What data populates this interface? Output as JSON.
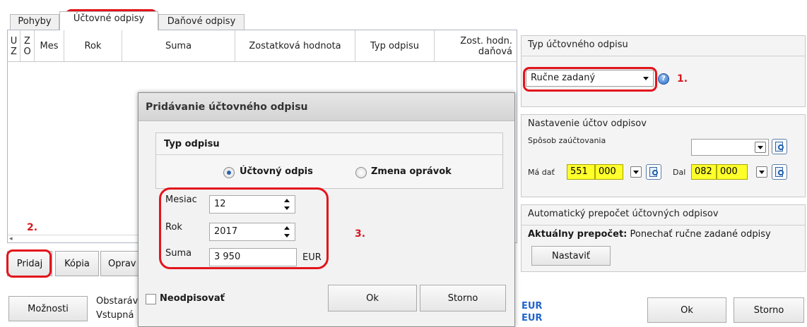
{
  "tabs": [
    {
      "label": "Pohyby",
      "active": false
    },
    {
      "label": "Účtovné odpisy",
      "active": true
    },
    {
      "label": "Daňové odpisy",
      "active": false
    }
  ],
  "grid": {
    "columns": [
      {
        "key": "uz",
        "label": "U Z"
      },
      {
        "key": "zo",
        "label": "Z O"
      },
      {
        "key": "mes",
        "label": "Mes"
      },
      {
        "key": "rok",
        "label": "Rok"
      },
      {
        "key": "suma",
        "label": "Suma"
      },
      {
        "key": "zostatkova",
        "label": "Zostatková hodnota"
      },
      {
        "key": "typ",
        "label": "Typ odpisu"
      },
      {
        "key": "zost_danova",
        "label": "Zost. hodn. daňová"
      }
    ],
    "rows": [],
    "buttons": {
      "pridaj": "Pridaj",
      "kopia": "Kópia",
      "oprav": "Oprav"
    }
  },
  "typ_uctovneho_odpisu": {
    "title": "Typ účtovného odpisu",
    "selected": "Ručne zadaný"
  },
  "nastavenie_uctov": {
    "title": "Nastavenie účtov odpisov",
    "sposob_label": "Spôsob zaúčtovania",
    "sposob_value": "",
    "ma_dat_label": "Má dať",
    "ma_dat_ucet": "551",
    "ma_dat_analytika": "000",
    "dal_label": "Dal",
    "dal_ucet": "082",
    "dal_analytika": "000"
  },
  "automaticky_prepocet": {
    "title": "Automatický prepočet účtovných odpisov",
    "aktualny_label": "Aktuálny prepočet:",
    "aktualny_value": "Ponechať ručne zadané odpisy",
    "nastavit_button": "Nastaviť"
  },
  "annotations": {
    "one": "1.",
    "two": "2.",
    "three": "3."
  },
  "footer": {
    "moznosti_button": "Možnosti",
    "obstaravacia_label": "Obstaráv",
    "vstupna_label": "Vstupná",
    "currency_1": "EUR",
    "currency_2": "EUR",
    "ok_button": "Ok",
    "storno_button": "Storno"
  },
  "dialog": {
    "title": "Pridávanie účtovného odpisu",
    "group_title": "Typ odpisu",
    "radio_uctovny": "Účtovný odpis",
    "radio_zmena": "Zmena oprávok",
    "selected_radio": "uctovny",
    "mesiac_label": "Mesiac",
    "mesiac_value": "12",
    "rok_label": "Rok",
    "rok_value": "2017",
    "suma_label": "Suma",
    "suma_value": "3 950",
    "suma_currency": "EUR",
    "neodpisovat_label": "Neodpisovať",
    "neodpisovat_checked": false,
    "ok_button": "Ok",
    "storno_button": "Storno"
  },
  "colors": {
    "highlight_ring": "#e3141b",
    "yellow_field": "#ffff2b",
    "link_blue": "#2266cc"
  }
}
